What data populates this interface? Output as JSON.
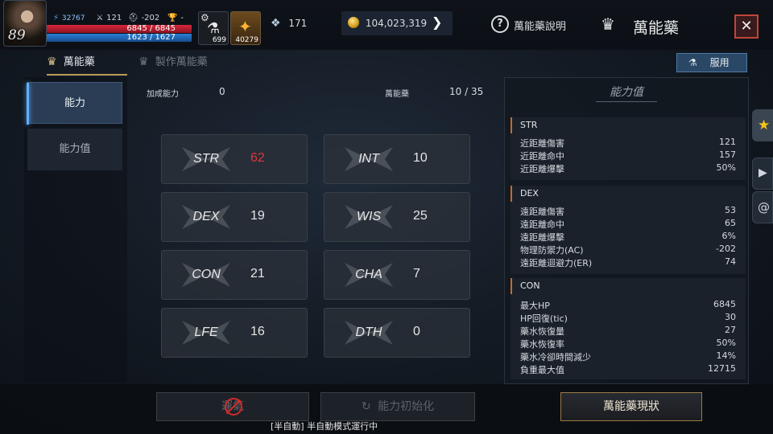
{
  "player": {
    "level": "89",
    "power": "32767",
    "stat2": "121",
    "stat3": "-202",
    "stat4": "-",
    "hp": "6845 / 6845",
    "mp": "1623 / 1627"
  },
  "items": [
    {
      "count": "699"
    },
    {
      "count": "40279"
    }
  ],
  "currency": {
    "crystal": "171",
    "gold": "104,023,319"
  },
  "header": {
    "help_label": "萬能藥說明",
    "title": "萬能藥"
  },
  "tabs": [
    {
      "label": "萬能藥"
    },
    {
      "label": "製作萬能藥"
    }
  ],
  "use_button": "服用",
  "left_menu": [
    {
      "label": "能力"
    },
    {
      "label": "能力值"
    }
  ],
  "summary": {
    "bonus_label": "加成能力",
    "bonus_value": "0",
    "elixir_label": "萬能藥",
    "elixir_value": "10 / 35"
  },
  "stats": [
    {
      "name": "STR",
      "value": "62",
      "highlight": true
    },
    {
      "name": "INT",
      "value": "10"
    },
    {
      "name": "DEX",
      "value": "19"
    },
    {
      "name": "WIS",
      "value": "25"
    },
    {
      "name": "CON",
      "value": "21"
    },
    {
      "name": "CHA",
      "value": "7"
    },
    {
      "name": "LFE",
      "value": "16"
    },
    {
      "name": "DTH",
      "value": "0"
    }
  ],
  "right_panel": {
    "title": "能力值",
    "sections": [
      {
        "name": "STR",
        "rows": [
          {
            "label": "近距離傷害",
            "value": "121"
          },
          {
            "label": "近距離命中",
            "value": "157"
          },
          {
            "label": "近距離爆擊",
            "value": "50%"
          }
        ]
      },
      {
        "name": "DEX",
        "rows": [
          {
            "label": "遠距離傷害",
            "value": "53"
          },
          {
            "label": "遠距離命中",
            "value": "65"
          },
          {
            "label": "遠距離爆擊",
            "value": "6%"
          },
          {
            "label": "物理防禦力(AC)",
            "value": "-202"
          },
          {
            "label": "遠距離迴避力(ER)",
            "value": "74"
          }
        ]
      },
      {
        "name": "CON",
        "rows": [
          {
            "label": "最大HP",
            "value": "6845"
          },
          {
            "label": "HP回復(tic)",
            "value": "30"
          },
          {
            "label": "藥水恢復量",
            "value": "27"
          },
          {
            "label": "藥水恢復率",
            "value": "50%"
          },
          {
            "label": "藥水冷卻時間減少",
            "value": "14%"
          },
          {
            "label": "負重最大值",
            "value": "12715"
          }
        ]
      }
    ]
  },
  "bottom": {
    "btn1": "運氣",
    "btn2": "能力初始化",
    "btn3": "萬能藥現狀"
  },
  "status_text": "[半自動] 半自動模式運行中",
  "colors": {
    "highlight_red": "#e0363c",
    "accent_gold": "#b99a5a",
    "accent_orange": "#c8692a"
  }
}
